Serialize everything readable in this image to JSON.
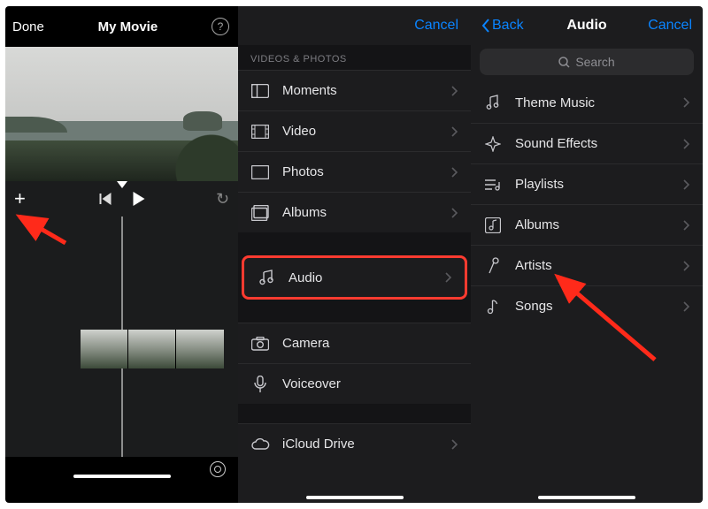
{
  "accent": "#0a84ff",
  "danger": "#ff3b30",
  "panel1": {
    "done": "Done",
    "title": "My Movie"
  },
  "panel2": {
    "cancel": "Cancel",
    "section_header": "VIDEOS & PHOTOS",
    "rows": {
      "moments": "Moments",
      "video": "Video",
      "photos": "Photos",
      "albums": "Albums",
      "audio": "Audio",
      "camera": "Camera",
      "voiceover": "Voiceover",
      "icloud": "iCloud Drive"
    }
  },
  "panel3": {
    "back": "Back",
    "title": "Audio",
    "cancel": "Cancel",
    "search_placeholder": "Search",
    "rows": {
      "theme": "Theme Music",
      "sfx": "Sound Effects",
      "playlists": "Playlists",
      "albums": "Albums",
      "artists": "Artists",
      "songs": "Songs"
    }
  }
}
